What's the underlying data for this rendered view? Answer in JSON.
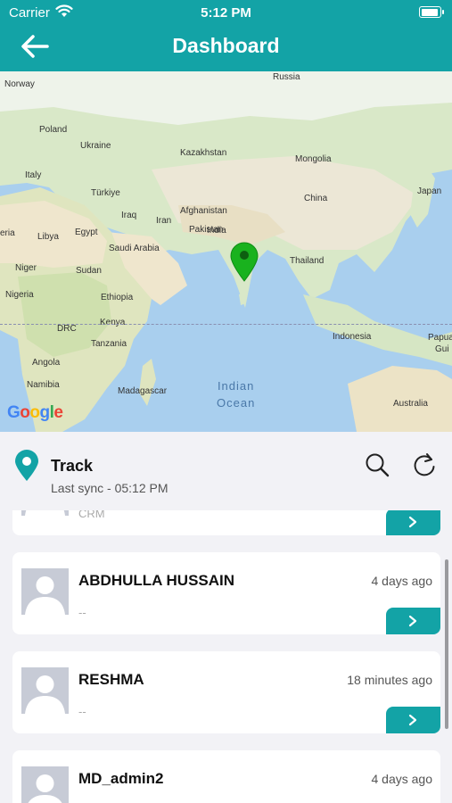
{
  "status": {
    "carrier": "Carrier",
    "time": "5:12 PM"
  },
  "nav": {
    "title": "Dashboard"
  },
  "map": {
    "labels": {
      "russia": "Russia",
      "norway": "Norway",
      "poland": "Poland",
      "ukraine": "Ukraine",
      "kazakhstan": "Kazakhstan",
      "mongolia": "Mongolia",
      "italy": "Italy",
      "turkiye": "Türkiye",
      "china": "China",
      "japan": "Japan",
      "iraq": "Iraq",
      "iran": "Iran",
      "afghanistan": "Afghanistan",
      "pakistan": "Pakistan",
      "algeria": "eria",
      "libya": "Libya",
      "egypt": "Egypt",
      "saudi_arabia": "Saudi Arabia",
      "india": "India",
      "thailand": "Thailand",
      "niger": "Niger",
      "sudan": "Sudan",
      "nigeria": "Nigeria",
      "ethiopia": "Ethiopia",
      "kenya": "Kenya",
      "drc": "DRC",
      "tanzania": "Tanzania",
      "indonesia": "Indonesia",
      "papua": "Papua",
      "papua2": "Gui",
      "angola": "Angola",
      "namibia": "Namibia",
      "madagascar": "Madagascar",
      "australia": "Australia"
    },
    "ocean_line1": "Indian",
    "ocean_line2": "Ocean",
    "google": [
      "G",
      "o",
      "o",
      "g",
      "l",
      "e"
    ]
  },
  "track": {
    "title": "Track",
    "sync": "Last sync - 05:12 PM"
  },
  "entries": [
    {
      "name": "",
      "subtitle": "CRM",
      "ago": ""
    },
    {
      "name": "ABDHULLA HUSSAIN",
      "subtitle": "--",
      "ago": "4 days ago"
    },
    {
      "name": "RESHMA",
      "subtitle": "--",
      "ago": "18 minutes ago"
    },
    {
      "name": "MD_admin2",
      "subtitle": "",
      "ago": "4 days ago"
    }
  ]
}
